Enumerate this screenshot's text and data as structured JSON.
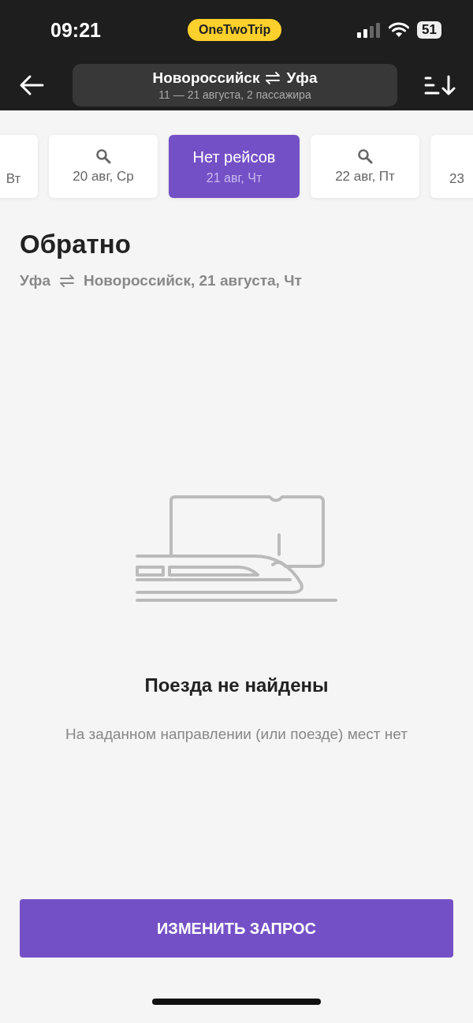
{
  "status_bar": {
    "time": "09:21",
    "app_badge": "OneTwoTrip",
    "battery": "51"
  },
  "header": {
    "route_from": "Новороссийск",
    "route_to": "Уфа",
    "details": "11 — 21 августа, 2 пассажира"
  },
  "date_tabs": [
    {
      "date": "Вт",
      "search_icon": false,
      "selected": false
    },
    {
      "date": "20 авг, Ср",
      "search_icon": true,
      "selected": false
    },
    {
      "label": "Нет рейсов",
      "date": "21 авг, Чт",
      "search_icon": false,
      "selected": true
    },
    {
      "date": "22 авг, Пт",
      "search_icon": true,
      "selected": false
    },
    {
      "date": "23",
      "search_icon": false,
      "selected": false
    }
  ],
  "section": {
    "title": "Обратно",
    "from": "Уфа",
    "to_and_date": "Новороссийск, 21 августа, Чт"
  },
  "empty_state": {
    "title": "Поезда не найдены",
    "message": "На заданном направлении (или поезде) мест нет"
  },
  "action_button": "ИЗМЕНИТЬ ЗАПРОС"
}
